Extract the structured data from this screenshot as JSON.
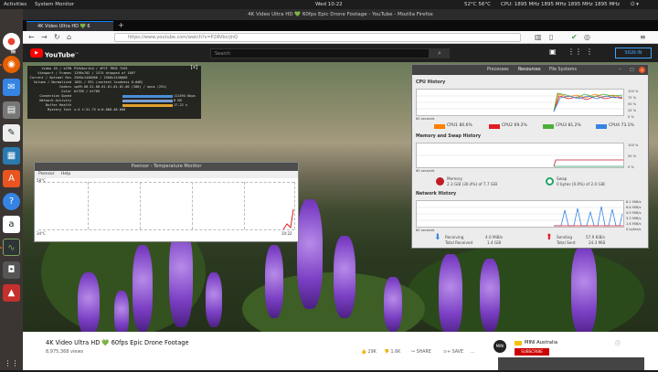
{
  "topbar": {
    "activities": "Activities",
    "app": "System Monitor",
    "clock": "Wed 10:22",
    "temp": "52°C 56°C",
    "cpu_freq": "CPU: 1895 MHz 1895 MHz 1895 MHz 1895 MHz"
  },
  "firefox": {
    "window_title": "4K Video Ultra HD 💚 60fps Epic Drone Footage - YouTube - Mozilla Firefox",
    "tab_label": "4K Video Ultra HD 💚 6",
    "url": "https://www.youtube.com/watch?v=P2AVbcrJnQ"
  },
  "youtube": {
    "logo_text": "YouTube",
    "logo_suffix": "CA",
    "search_placeholder": "Search",
    "signin": "SIGN IN"
  },
  "stats": {
    "rows": [
      {
        "label": "Video ID / sCPN",
        "value": "P2AVbcrJnQ / 4PCF 7MCB 7SG9"
      },
      {
        "label": "Viewport / Frames",
        "value": "1296x702 / 1574 dropped of 1097"
      },
      {
        "label": "Current / Optimal Res",
        "value": "2560x1440@60 / 2560x1440@60"
      },
      {
        "label": "Volume / Normalized",
        "value": "100% / 93% (content loudness 0.6dB)"
      },
      {
        "label": "Codecs",
        "value": "vp09.00.51.08.01.01.01.01.00 (308) / opus (251)"
      },
      {
        "label": "Color",
        "value": "bt709 / bt709"
      },
      {
        "label": "Connection Speed",
        "value": "112494 Kbps"
      },
      {
        "label": "Network Activity",
        "value": "0 KB"
      },
      {
        "label": "Buffer Health",
        "value": "17.22 s"
      },
      {
        "label": "Mystery Text",
        "value": "s:4 t:31.75 b:0.000-48.000"
      }
    ]
  },
  "psensor": {
    "title": "Psensor - Temperature Monitor",
    "menu": [
      "Psensor",
      "Help"
    ],
    "y_top": "58°C",
    "y_bottom": "34°C",
    "x_time": "10:22"
  },
  "sysmon": {
    "tabs": [
      "Processes",
      "Resources",
      "File Systems"
    ],
    "cpu_history": "CPU History",
    "cpu_xlabel": "60 seconds",
    "cpu_ylabels": [
      "100 %",
      "75 %",
      "50 %",
      "25 %",
      "0 %"
    ],
    "cpus": [
      {
        "label": "CPU1",
        "value": "80.6%",
        "color": "#ff7f00"
      },
      {
        "label": "CPU2",
        "value": "69.2%",
        "color": "#e01b24"
      },
      {
        "label": "CPU3",
        "value": "81.2%",
        "color": "#4caf38"
      },
      {
        "label": "CPU4",
        "value": "73.1%",
        "color": "#3584e4"
      }
    ],
    "memswap_history": "Memory and Swap History",
    "mem_xlabel": "60 seconds",
    "mem_ylabels": [
      "100 %",
      "50 %",
      "0 %"
    ],
    "memory_label": "Memory",
    "memory_value": "2.3 GiB (30.4%) of 7.7 GiB",
    "swap_label": "Swap",
    "swap_value": "0 bytes (0.0%) of 2.0 GiB",
    "net_history": "Network History",
    "net_xlabel": "60 seconds",
    "net_ylabels": [
      "8.2 MiB/s",
      "6.6 MiB/s",
      "4.9 MiB/s",
      "3.3 MiB/s",
      "1.6 MiB/s",
      "0 bytes/s"
    ],
    "receiving_label": "Receiving",
    "receiving_value": "4.0 MiB/s",
    "total_received_label": "Total Received",
    "total_received_value": "1.4 GiB",
    "sending_label": "Sending",
    "sending_value": "57.9 KiB/s",
    "total_sent_label": "Total Sent",
    "total_sent_value": "24.3 MiB"
  },
  "video_info": {
    "title": "4K Video Ultra HD 💚 60fps Epic Drone Footage",
    "views": "8,975,368 views",
    "likes": "29K",
    "dislikes": "1.6K",
    "share": "SHARE",
    "save": "SAVE",
    "more": "...",
    "channel": "MINI Australia",
    "subscribe": "SUBSCRIBE"
  }
}
